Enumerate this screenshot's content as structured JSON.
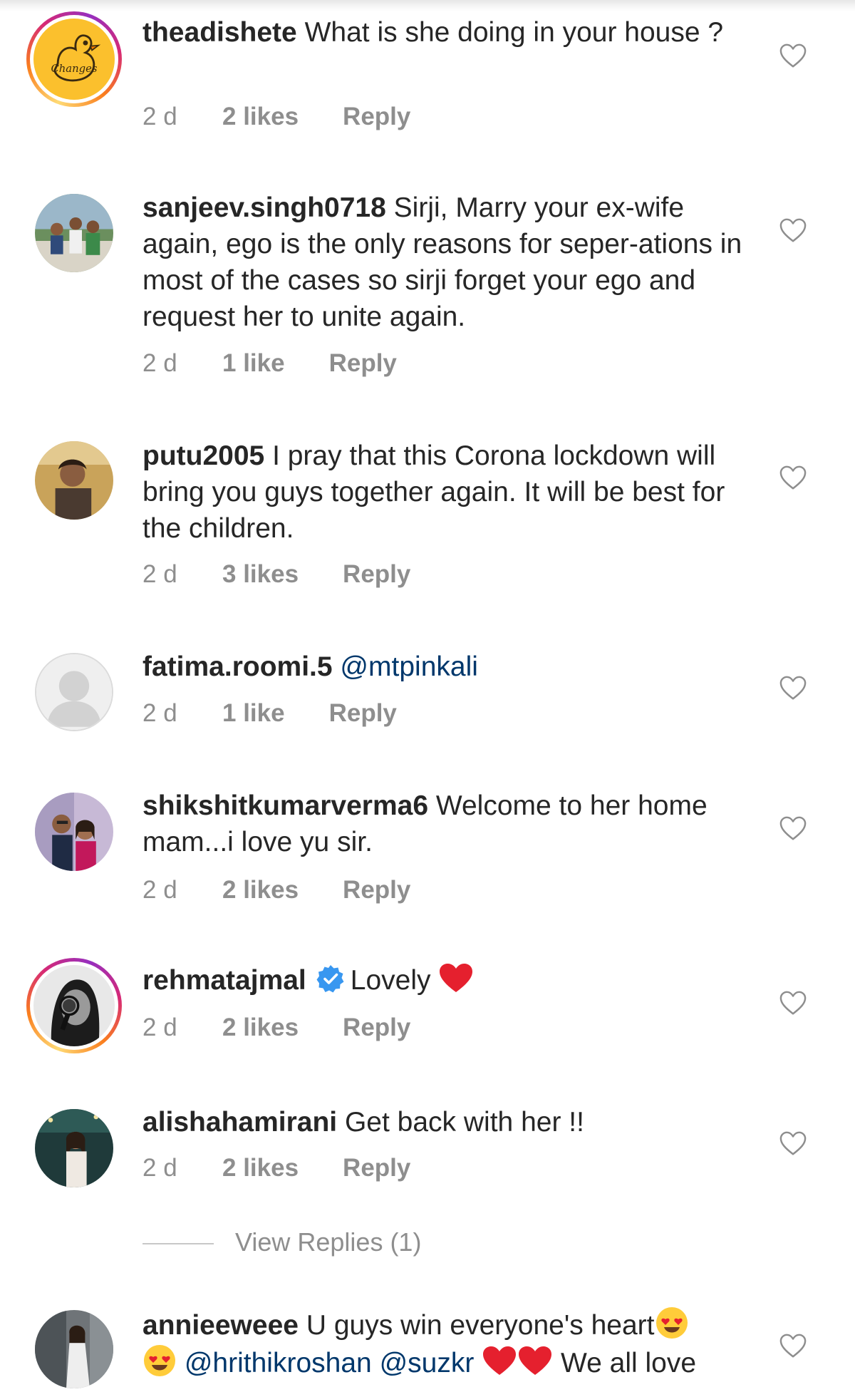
{
  "colors": {
    "text": "#262626",
    "meta": "#8e8e8e",
    "mention": "#00376b",
    "verified": "#3897f0",
    "emoji_heart": "#e5202e"
  },
  "icons": {
    "like": "heart-outline-icon",
    "verified": "verified-badge-icon",
    "heart_emoji": "red-heart-emoji",
    "face_emoji": "heart-eyes-emoji"
  },
  "comments": [
    {
      "username": "theadishete",
      "text": "What is she doing in your house ?",
      "time": "2 d",
      "likes": "2 likes",
      "reply": "Reply",
      "avatar_logo_text": "Changes"
    },
    {
      "username": "sanjeev.singh0718",
      "text": "Sirji, Marry your ex-wife again, ego is the only reasons for seper-ations in most of the cases so sirji forget your ego and request her to unite again.",
      "time": "2 d",
      "likes": "1 like",
      "reply": "Reply"
    },
    {
      "username": "putu2005",
      "text": "I pray that this Corona lockdown will bring you guys together again. It will be best for the children.",
      "time": "2 d",
      "likes": "3 likes",
      "reply": "Reply"
    },
    {
      "username": "fatima.roomi.5",
      "text": "@mtpinkali",
      "time": "2 d",
      "likes": "1 like",
      "reply": "Reply"
    },
    {
      "username": "shikshitkumarverma6",
      "text": "Welcome to her home mam...i love yu sir.",
      "time": "2 d",
      "likes": "2 likes",
      "reply": "Reply"
    },
    {
      "username": "rehmatajmal",
      "text": "Lovely",
      "time": "2 d",
      "likes": "2 likes",
      "reply": "Reply"
    },
    {
      "username": "alishahamirani",
      "text": "Get back with her !!",
      "time": "2 d",
      "likes": "2 likes",
      "reply": "Reply"
    },
    {
      "username": "annieeweee",
      "text_part1": "U guys win everyone's heart",
      "mention1": "@hrithikroshan",
      "mention2": "@suzkr",
      "text_part2": "We all love"
    }
  ],
  "view_replies": "View Replies (1)"
}
